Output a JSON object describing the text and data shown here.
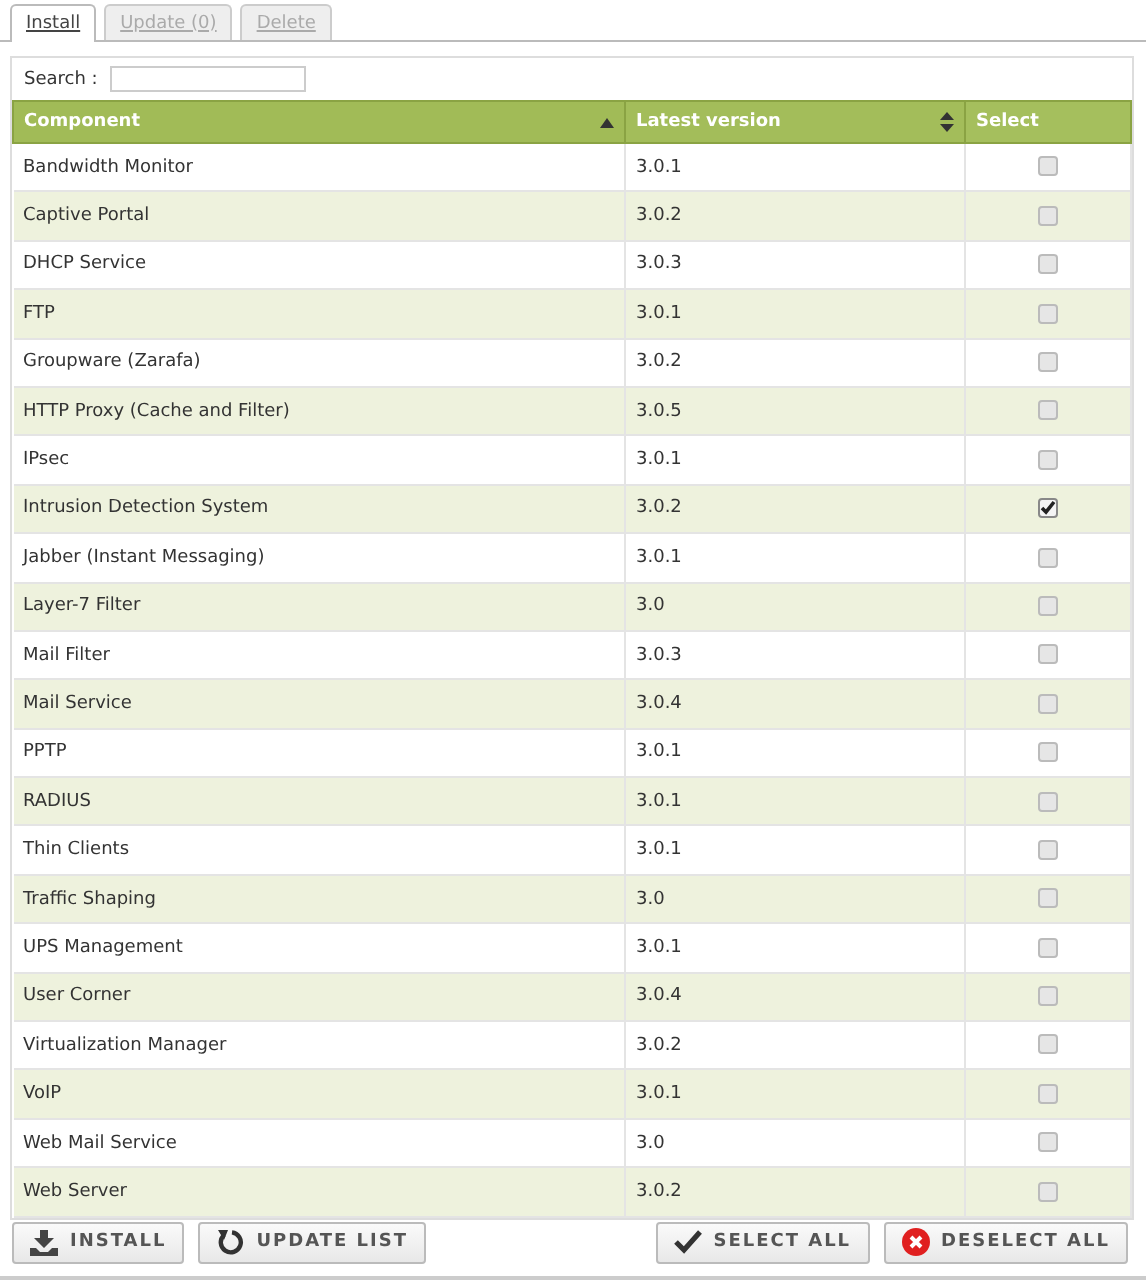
{
  "tabs": [
    {
      "label": "Install",
      "selected": true
    },
    {
      "label": "Update (0)",
      "selected": false
    },
    {
      "label": "Delete",
      "selected": false
    }
  ],
  "search": {
    "label": "Search :"
  },
  "table": {
    "columns": [
      {
        "label": "Component",
        "sortable": true,
        "sorted": true
      },
      {
        "label": "Latest version",
        "sortable": true,
        "sorted": false
      },
      {
        "label": "Select",
        "sortable": false,
        "sorted": false
      }
    ],
    "rows": [
      {
        "component": "Bandwidth Monitor",
        "version": "3.0.1",
        "checked": false
      },
      {
        "component": "Captive Portal",
        "version": "3.0.2",
        "checked": false
      },
      {
        "component": "DHCP Service",
        "version": "3.0.3",
        "checked": false
      },
      {
        "component": "FTP",
        "version": "3.0.1",
        "checked": false
      },
      {
        "component": "Groupware (Zarafa)",
        "version": "3.0.2",
        "checked": false
      },
      {
        "component": "HTTP Proxy (Cache and Filter)",
        "version": "3.0.5",
        "checked": false
      },
      {
        "component": "IPsec",
        "version": "3.0.1",
        "checked": false
      },
      {
        "component": "Intrusion Detection System",
        "version": "3.0.2",
        "checked": true
      },
      {
        "component": "Jabber (Instant Messaging)",
        "version": "3.0.1",
        "checked": false
      },
      {
        "component": "Layer-7 Filter",
        "version": "3.0",
        "checked": false
      },
      {
        "component": "Mail Filter",
        "version": "3.0.3",
        "checked": false
      },
      {
        "component": "Mail Service",
        "version": "3.0.4",
        "checked": false
      },
      {
        "component": "PPTP",
        "version": "3.0.1",
        "checked": false
      },
      {
        "component": "RADIUS",
        "version": "3.0.1",
        "checked": false
      },
      {
        "component": "Thin Clients",
        "version": "3.0.1",
        "checked": false
      },
      {
        "component": "Traffic Shaping",
        "version": "3.0",
        "checked": false
      },
      {
        "component": "UPS Management",
        "version": "3.0.1",
        "checked": false
      },
      {
        "component": "User Corner",
        "version": "3.0.4",
        "checked": false
      },
      {
        "component": "Virtualization Manager",
        "version": "3.0.2",
        "checked": false
      },
      {
        "component": "VoIP",
        "version": "3.0.1",
        "checked": false
      },
      {
        "component": "Web Mail Service",
        "version": "3.0",
        "checked": false
      },
      {
        "component": "Web Server",
        "version": "3.0.2",
        "checked": false
      }
    ]
  },
  "buttons": [
    {
      "kind": "install",
      "label": "INSTALL"
    },
    {
      "kind": "update",
      "label": "UPDATE LIST"
    },
    {
      "kind": "select",
      "label": "SELECT ALL"
    },
    {
      "kind": "deselect",
      "label": "DESELECT ALL"
    }
  ]
}
